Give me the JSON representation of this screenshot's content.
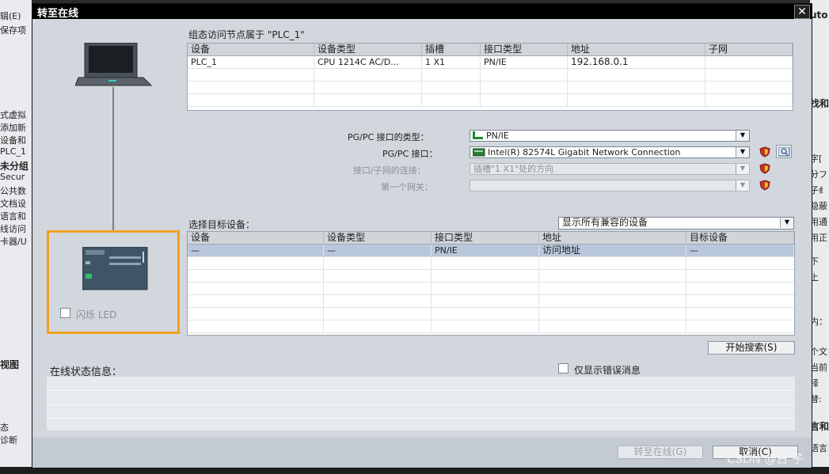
{
  "background": {
    "left_fragments": [
      {
        "text": "辑(E)",
        "bold": false
      },
      {
        "text": "保存项",
        "bold": false
      },
      {
        "text": "式虚拟",
        "bold": false
      },
      {
        "text": "添加新",
        "bold": false
      },
      {
        "text": "设备和",
        "bold": false
      },
      {
        "text": "PLC_1",
        "bold": false
      },
      {
        "text": "未分组",
        "bold": true
      },
      {
        "text": "Secur",
        "bold": false
      },
      {
        "text": "公共数",
        "bold": false
      },
      {
        "text": "文档设",
        "bold": false
      },
      {
        "text": "语言和",
        "bold": false
      },
      {
        "text": "线访问",
        "bold": false
      },
      {
        "text": "卡器/U",
        "bold": false
      },
      {
        "text": "视图",
        "bold": true
      },
      {
        "text": "态",
        "bold": false
      },
      {
        "text": "诊断",
        "bold": false
      }
    ],
    "right_fragments": [
      {
        "text": "uto",
        "bold": true
      },
      {
        "text": "找和",
        "bold": true
      },
      {
        "text": "字[",
        "bold": false
      },
      {
        "text": "分フ",
        "bold": false
      },
      {
        "text": "子纟",
        "bold": false
      },
      {
        "text": "隐蔽",
        "bold": false
      },
      {
        "text": "用通",
        "bold": false
      },
      {
        "text": "用正",
        "bold": false
      },
      {
        "text": "下",
        "bold": false
      },
      {
        "text": "上",
        "bold": false
      },
      {
        "text": "内：",
        "bold": false
      },
      {
        "text": "个文",
        "bold": false
      },
      {
        "text": "当前",
        "bold": false
      },
      {
        "text": "择",
        "bold": false
      },
      {
        "text": "替:",
        "bold": false
      },
      {
        "text": "言和",
        "bold": true
      },
      {
        "text": "语言",
        "bold": false
      }
    ]
  },
  "dialog": {
    "title": "转至在线",
    "close_glyph": "✕",
    "access_table_caption": "组态访问节点属于 \"PLC_1\"",
    "access_table": {
      "headers": [
        "设备",
        "设备类型",
        "插槽",
        "接口类型",
        "地址",
        "子网"
      ],
      "rows": [
        [
          "PLC_1",
          "CPU 1214C AC/D...",
          "1 X1",
          "PN/IE",
          "192.168.0.1",
          ""
        ],
        [
          "",
          "",
          "",
          "",
          "",
          ""
        ],
        [
          "",
          "",
          "",
          "",
          "",
          ""
        ],
        [
          "",
          "",
          "",
          "",
          "",
          ""
        ]
      ]
    },
    "pgpc_type_label": "PG/PC 接口的类型：",
    "pgpc_type_value": "PN/IE",
    "pgpc_iface_label": "PG/PC 接口：",
    "pgpc_iface_value": "Intel(R) 82574L Gigabit Network Connection",
    "subnet_conn_label": "接口/子网的连接：",
    "subnet_conn_value": "插槽\"1 X1\"处的方向",
    "gateway_label": "第一个网关：",
    "gateway_value": "",
    "select_target_label": "选择目标设备：",
    "filter_value": "显示所有兼容的设备",
    "target_table": {
      "headers": [
        "设备",
        "设备类型",
        "接口类型",
        "地址",
        "目标设备"
      ],
      "rows": [
        [
          "—",
          "—",
          "PN/IE",
          "访问地址",
          "—"
        ],
        [
          "",
          "",
          "",
          "",
          ""
        ],
        [
          "",
          "",
          "",
          "",
          ""
        ],
        [
          "",
          "",
          "",
          "",
          ""
        ],
        [
          "",
          "",
          "",
          "",
          ""
        ],
        [
          "",
          "",
          "",
          "",
          ""
        ],
        [
          "",
          "",
          "",
          "",
          ""
        ]
      ]
    },
    "flash_led_label": "闪烁 LED",
    "start_search_label": "开始搜索(S)",
    "online_status_label": "在线状态信息：",
    "only_errors_label": "仅显示错误消息",
    "go_online_label": "转至在线(G)",
    "cancel_label": "取消(C)",
    "watermark": "CSDN @日 子"
  },
  "colors": {
    "accent_orange": "#f0a020",
    "selected_row": "#b9c7db",
    "green_icon": "#1c8a2e"
  }
}
